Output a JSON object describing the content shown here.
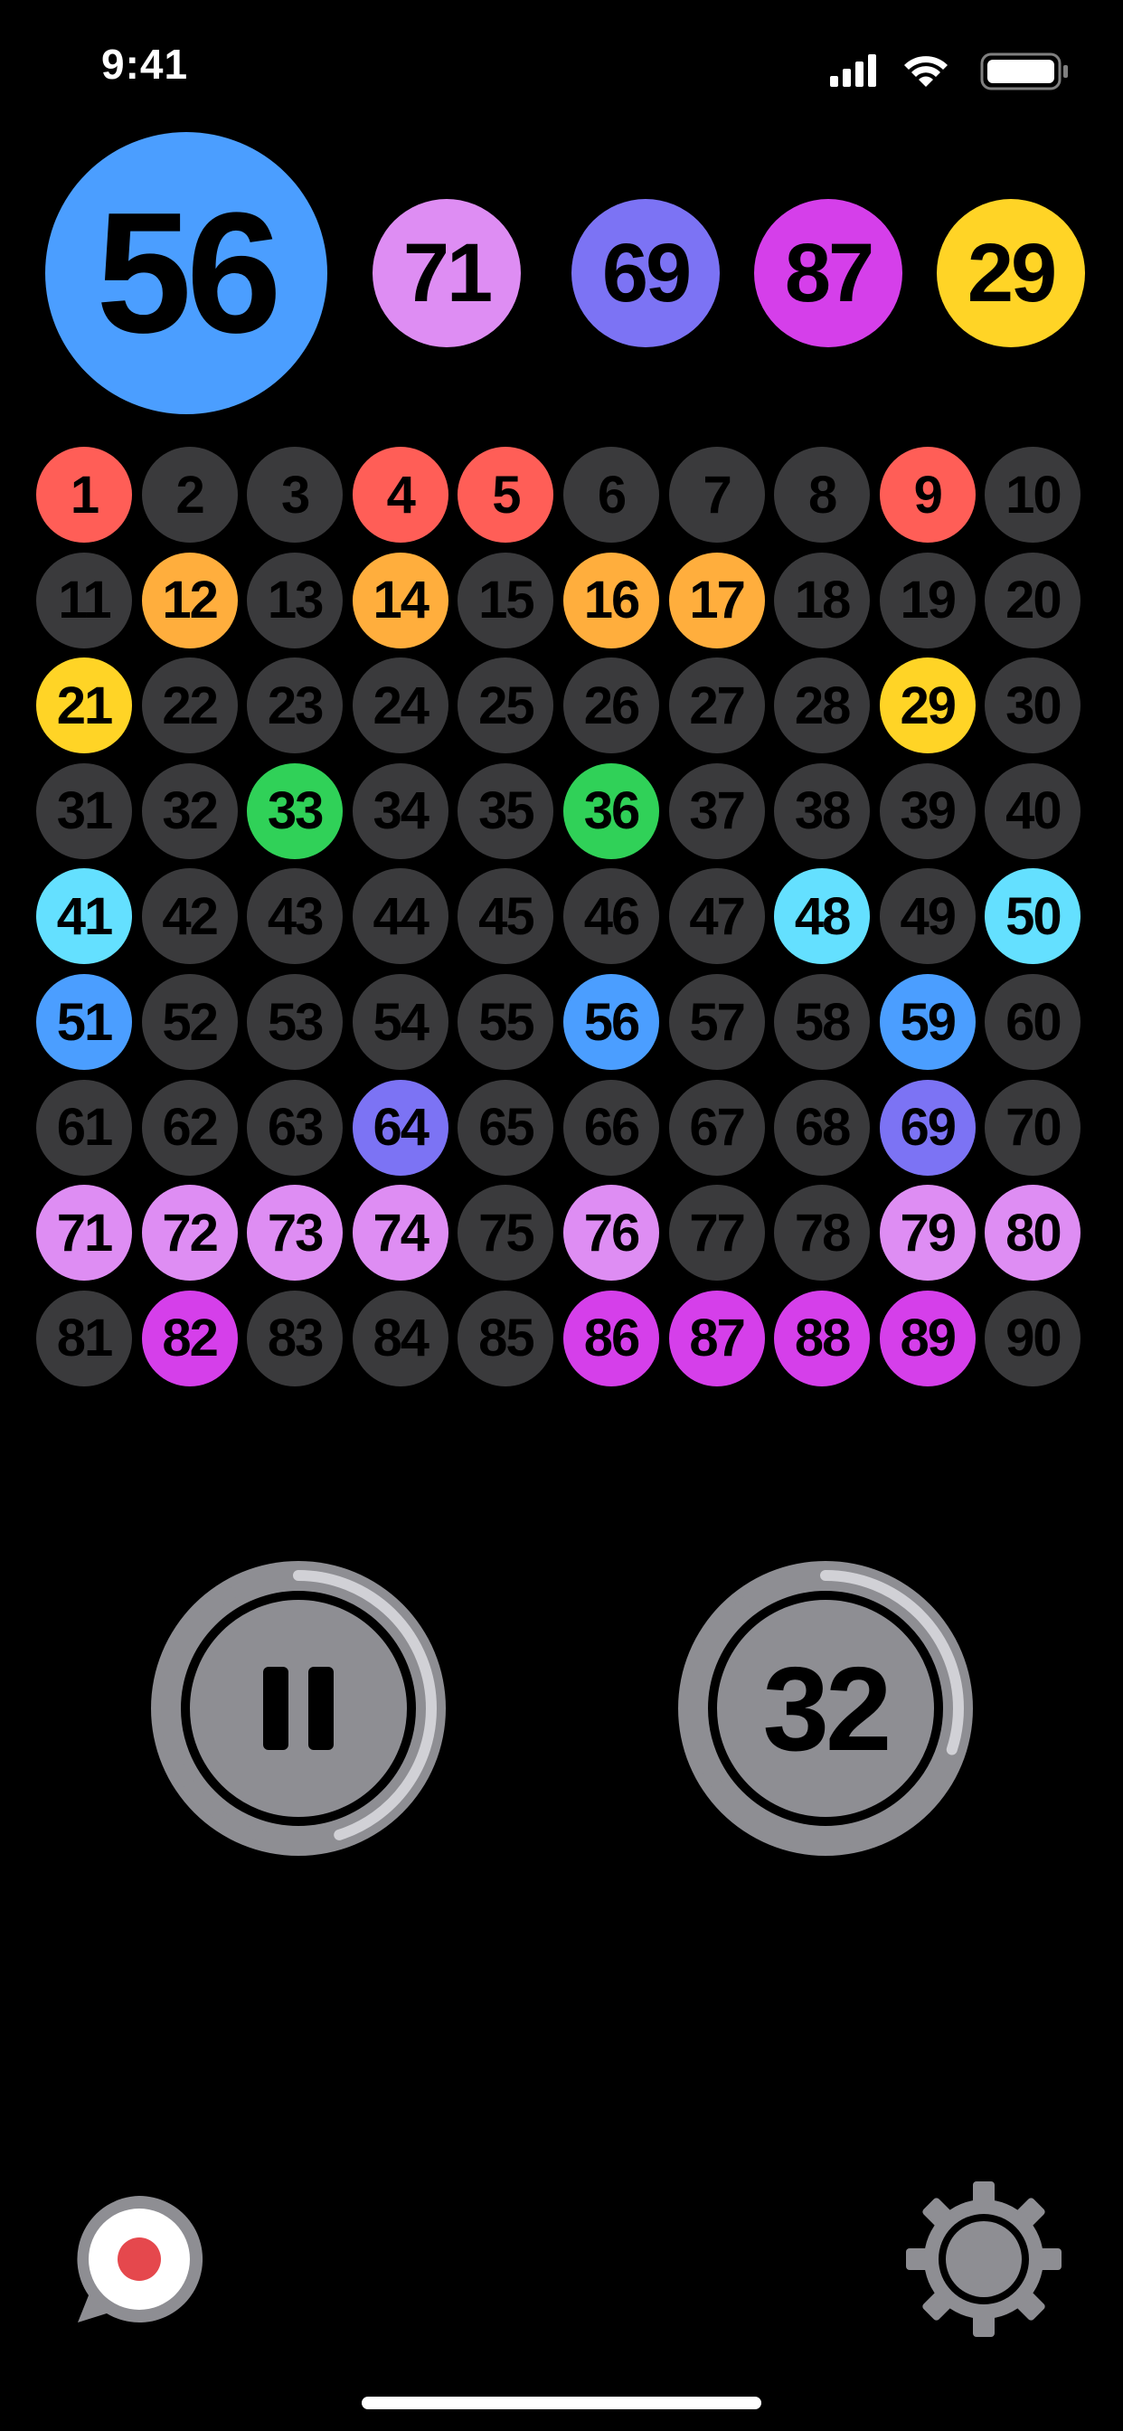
{
  "status_bar": {
    "time": "9:41"
  },
  "current_ball": {
    "number": "56",
    "color": "#4B9EFF"
  },
  "recent_balls": [
    {
      "number": "71",
      "color": "#DE8DF3"
    },
    {
      "number": "69",
      "color": "#7C73F4"
    },
    {
      "number": "87",
      "color": "#D53FEA"
    },
    {
      "number": "29",
      "color": "#FFD426"
    }
  ],
  "board": {
    "uncalled_color": "#3A3A3C",
    "cells": [
      {
        "n": "1",
        "c": "#FF5E57"
      },
      {
        "n": "2",
        "c": null
      },
      {
        "n": "3",
        "c": null
      },
      {
        "n": "4",
        "c": "#FF5E57"
      },
      {
        "n": "5",
        "c": "#FF5E57"
      },
      {
        "n": "6",
        "c": null
      },
      {
        "n": "7",
        "c": null
      },
      {
        "n": "8",
        "c": null
      },
      {
        "n": "9",
        "c": "#FF5E57"
      },
      {
        "n": "10",
        "c": null
      },
      {
        "n": "11",
        "c": null
      },
      {
        "n": "12",
        "c": "#FFAE3D"
      },
      {
        "n": "13",
        "c": null
      },
      {
        "n": "14",
        "c": "#FFAE3D"
      },
      {
        "n": "15",
        "c": null
      },
      {
        "n": "16",
        "c": "#FFAE3D"
      },
      {
        "n": "17",
        "c": "#FFAE3D"
      },
      {
        "n": "18",
        "c": null
      },
      {
        "n": "19",
        "c": null
      },
      {
        "n": "20",
        "c": null
      },
      {
        "n": "21",
        "c": "#FFD426"
      },
      {
        "n": "22",
        "c": null
      },
      {
        "n": "23",
        "c": null
      },
      {
        "n": "24",
        "c": null
      },
      {
        "n": "25",
        "c": null
      },
      {
        "n": "26",
        "c": null
      },
      {
        "n": "27",
        "c": null
      },
      {
        "n": "28",
        "c": null
      },
      {
        "n": "29",
        "c": "#FFD426"
      },
      {
        "n": "30",
        "c": null
      },
      {
        "n": "31",
        "c": null
      },
      {
        "n": "32",
        "c": null
      },
      {
        "n": "33",
        "c": "#30D158"
      },
      {
        "n": "34",
        "c": null
      },
      {
        "n": "35",
        "c": null
      },
      {
        "n": "36",
        "c": "#30D158"
      },
      {
        "n": "37",
        "c": null
      },
      {
        "n": "38",
        "c": null
      },
      {
        "n": "39",
        "c": null
      },
      {
        "n": "40",
        "c": null
      },
      {
        "n": "41",
        "c": "#64E0FF"
      },
      {
        "n": "42",
        "c": null
      },
      {
        "n": "43",
        "c": null
      },
      {
        "n": "44",
        "c": null
      },
      {
        "n": "45",
        "c": null
      },
      {
        "n": "46",
        "c": null
      },
      {
        "n": "47",
        "c": null
      },
      {
        "n": "48",
        "c": "#64E0FF"
      },
      {
        "n": "49",
        "c": null
      },
      {
        "n": "50",
        "c": "#64E0FF"
      },
      {
        "n": "51",
        "c": "#4B9EFF"
      },
      {
        "n": "52",
        "c": null
      },
      {
        "n": "53",
        "c": null
      },
      {
        "n": "54",
        "c": null
      },
      {
        "n": "55",
        "c": null
      },
      {
        "n": "56",
        "c": "#4B9EFF"
      },
      {
        "n": "57",
        "c": null
      },
      {
        "n": "58",
        "c": null
      },
      {
        "n": "59",
        "c": "#4B9EFF"
      },
      {
        "n": "60",
        "c": null
      },
      {
        "n": "61",
        "c": null
      },
      {
        "n": "62",
        "c": null
      },
      {
        "n": "63",
        "c": null
      },
      {
        "n": "64",
        "c": "#7C73F4"
      },
      {
        "n": "65",
        "c": null
      },
      {
        "n": "66",
        "c": null
      },
      {
        "n": "67",
        "c": null
      },
      {
        "n": "68",
        "c": null
      },
      {
        "n": "69",
        "c": "#7C73F4"
      },
      {
        "n": "70",
        "c": null
      },
      {
        "n": "71",
        "c": "#DE8DF3"
      },
      {
        "n": "72",
        "c": "#DE8DF3"
      },
      {
        "n": "73",
        "c": "#DE8DF3"
      },
      {
        "n": "74",
        "c": "#DE8DF3"
      },
      {
        "n": "75",
        "c": null
      },
      {
        "n": "76",
        "c": "#DE8DF3"
      },
      {
        "n": "77",
        "c": null
      },
      {
        "n": "78",
        "c": null
      },
      {
        "n": "79",
        "c": "#DE8DF3"
      },
      {
        "n": "80",
        "c": "#DE8DF3"
      },
      {
        "n": "81",
        "c": null
      },
      {
        "n": "82",
        "c": "#D53FEA"
      },
      {
        "n": "83",
        "c": null
      },
      {
        "n": "84",
        "c": null
      },
      {
        "n": "85",
        "c": null
      },
      {
        "n": "86",
        "c": "#D53FEA"
      },
      {
        "n": "87",
        "c": "#D53FEA"
      },
      {
        "n": "88",
        "c": "#D53FEA"
      },
      {
        "n": "89",
        "c": "#D53FEA"
      },
      {
        "n": "90",
        "c": null
      }
    ]
  },
  "controls": {
    "pause": {
      "icon": "pause-icon",
      "progress": 0.45
    },
    "countdown": {
      "value": "32",
      "progress": 0.3
    }
  },
  "footer": {
    "cast_icon": "cast-chat-icon",
    "settings_icon": "gear-icon"
  },
  "colors": {
    "control_gray": "#8E8E93",
    "ring_progress": "#D1D1D6",
    "record_dot": "#E5484D"
  }
}
